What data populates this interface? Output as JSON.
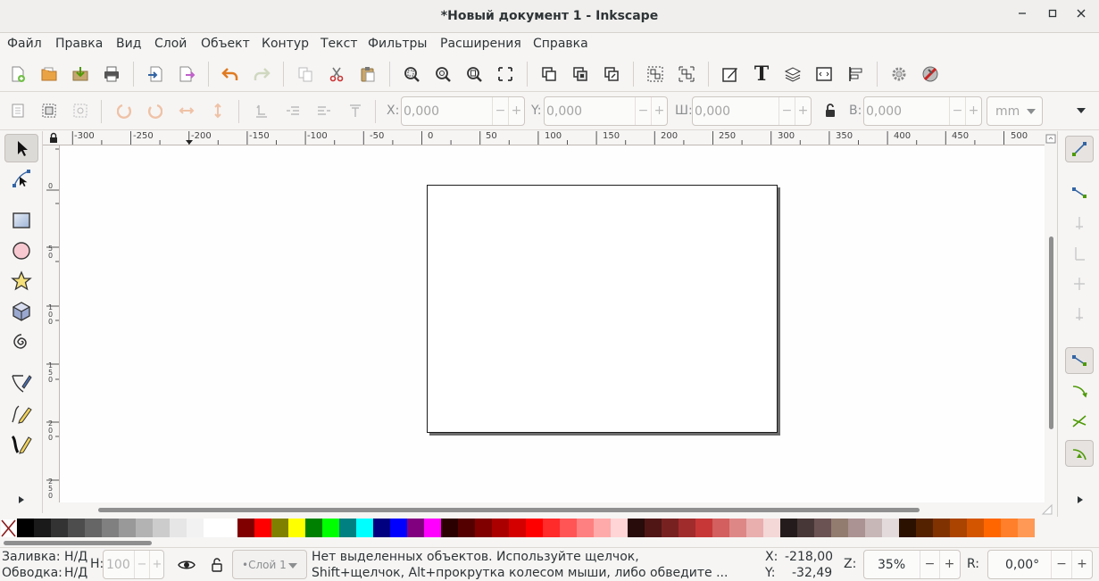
{
  "window": {
    "title": "*Новый документ 1 - Inkscape",
    "minimize_glyph": "✕",
    "maximize_glyph": "☐",
    "close_glyph": "✕"
  },
  "menu": [
    {
      "label": "Файл"
    },
    {
      "label": "Правка"
    },
    {
      "label": "Вид"
    },
    {
      "label": "Слой"
    },
    {
      "label": "Объект"
    },
    {
      "label": "Контур"
    },
    {
      "label": "Текст"
    },
    {
      "label": "Фильтры"
    },
    {
      "label": "Расширения"
    },
    {
      "label": "Справка"
    }
  ],
  "commands": {
    "text_tool_glyph": "T"
  },
  "controls": {
    "x_label": "X:",
    "x_value": "0,000",
    "y_label": "Y:",
    "y_value": "0,000",
    "w_label": "Ш:",
    "w_value": "0,000",
    "h_label": "В:",
    "h_value": "0,000",
    "units": "mm",
    "minus": "−",
    "plus": "+"
  },
  "ruler": {
    "top_ticks": [
      "-300",
      "-250",
      "-200",
      "-150",
      "-100",
      "-50",
      "0",
      "50",
      "100",
      "150",
      "200",
      "250",
      "300",
      "350",
      "400",
      "450",
      "500"
    ],
    "left_ticks": [
      "0",
      "5\n0",
      "1\n0\n0",
      "1\n5\n0",
      "2\n0\n0",
      "2\n5\n0"
    ]
  },
  "palette": {
    "colors": [
      "#000000",
      "#1a1a1a",
      "#333333",
      "#4d4d4d",
      "#666666",
      "#808080",
      "#999999",
      "#b3b3b3",
      "#cccccc",
      "#e6e6e6",
      "#f2f2f2",
      "#ffffff",
      "#ffffff",
      "#800000",
      "#ff0000",
      "#808000",
      "#ffff00",
      "#008000",
      "#00ff00",
      "#008080",
      "#00ffff",
      "#000080",
      "#0000ff",
      "#800080",
      "#ff00ff",
      "#2b0000",
      "#550000",
      "#800000",
      "#aa0000",
      "#d40000",
      "#ff0000",
      "#ff2a2a",
      "#ff5555",
      "#ff8080",
      "#ffaaaa",
      "#ffd5d5",
      "#280b0b",
      "#501616",
      "#782121",
      "#a02c2c",
      "#c83737",
      "#d35f5f",
      "#de8787",
      "#e9afaf",
      "#f4d7d7",
      "#241c1c",
      "#483737",
      "#6c5353",
      "#917c6f",
      "#ac9393",
      "#c8b7b7",
      "#e3dbdb",
      "#2b1100",
      "#552200",
      "#803300",
      "#aa4400",
      "#d45500",
      "#ff6600",
      "#ff7f2a",
      "#ff9955"
    ]
  },
  "status": {
    "fill_label": "Заливка:",
    "fill_value": "Н/Д",
    "stroke_label": "Обводка:",
    "stroke_value": "Н/Д",
    "opacity_label": "Н:",
    "opacity_value": "100",
    "layer": "•Слой 1",
    "message_line1": "Нет выделенных объектов. Используйте щелчок,",
    "message_line2": "Shift+щелчок, Alt+прокрутка колесом мыши, либо обведите ...",
    "cursor_x_label": "X:",
    "cursor_x": "-218,00",
    "cursor_y_label": "Y:",
    "cursor_y": "-32,49",
    "zoom_label": "Z:",
    "zoom_value": "35%",
    "rotate_label": "R:",
    "rotate_value": "0,00°"
  }
}
